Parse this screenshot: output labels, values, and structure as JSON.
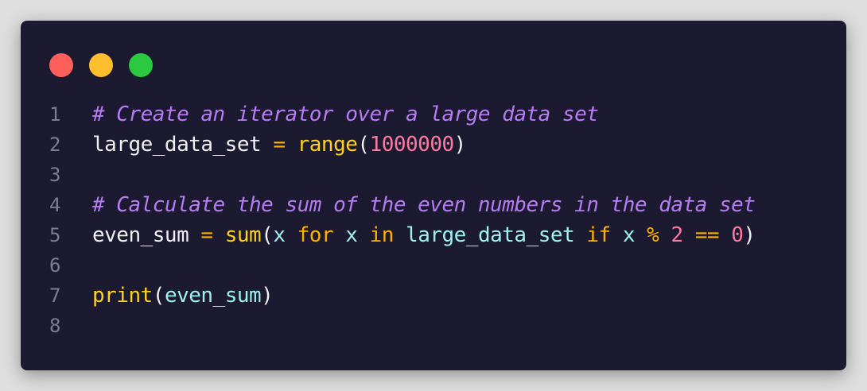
{
  "window": {
    "controls": [
      {
        "name": "close-dot",
        "color": "#ff5f5a"
      },
      {
        "name": "minimize-dot",
        "color": "#ffbe2e"
      },
      {
        "name": "maximize-dot",
        "color": "#2ac93f"
      }
    ]
  },
  "colors": {
    "background": "#1b1a30",
    "comment": "#b77cf2",
    "identifier": "#f2f2f2",
    "variable": "#9ef0f3",
    "operator": "#ffb000",
    "builtin": "#ffd21f",
    "number": "#ff7aa0",
    "line_number": "#7c7c97"
  },
  "code": {
    "lines": [
      {
        "number": "1",
        "tokens": [
          {
            "text": "# Create an iterator over a large data set",
            "type": "comment"
          }
        ]
      },
      {
        "number": "2",
        "tokens": [
          {
            "text": "large_data_set",
            "type": "ident"
          },
          {
            "text": " ",
            "type": "ident"
          },
          {
            "text": "=",
            "type": "op"
          },
          {
            "text": " ",
            "type": "ident"
          },
          {
            "text": "range",
            "type": "builtin"
          },
          {
            "text": "(",
            "type": "paren"
          },
          {
            "text": "1000000",
            "type": "num"
          },
          {
            "text": ")",
            "type": "paren"
          }
        ]
      },
      {
        "number": "3",
        "tokens": []
      },
      {
        "number": "4",
        "tokens": [
          {
            "text": "# Calculate the sum of the even numbers in the data set",
            "type": "comment"
          }
        ]
      },
      {
        "number": "5",
        "tokens": [
          {
            "text": "even_sum",
            "type": "ident"
          },
          {
            "text": " ",
            "type": "ident"
          },
          {
            "text": "=",
            "type": "op"
          },
          {
            "text": " ",
            "type": "ident"
          },
          {
            "text": "sum",
            "type": "builtin"
          },
          {
            "text": "(",
            "type": "paren"
          },
          {
            "text": "x",
            "type": "var"
          },
          {
            "text": " ",
            "type": "ident"
          },
          {
            "text": "for",
            "type": "kw"
          },
          {
            "text": " ",
            "type": "ident"
          },
          {
            "text": "x",
            "type": "var"
          },
          {
            "text": " ",
            "type": "ident"
          },
          {
            "text": "in",
            "type": "kw"
          },
          {
            "text": " ",
            "type": "ident"
          },
          {
            "text": "large_data_set",
            "type": "var"
          },
          {
            "text": " ",
            "type": "ident"
          },
          {
            "text": "if",
            "type": "kw"
          },
          {
            "text": " ",
            "type": "ident"
          },
          {
            "text": "x",
            "type": "var"
          },
          {
            "text": " ",
            "type": "ident"
          },
          {
            "text": "%",
            "type": "op"
          },
          {
            "text": " ",
            "type": "ident"
          },
          {
            "text": "2",
            "type": "num"
          },
          {
            "text": " ",
            "type": "ident"
          },
          {
            "text": "==",
            "type": "op"
          },
          {
            "text": " ",
            "type": "ident"
          },
          {
            "text": "0",
            "type": "num"
          },
          {
            "text": ")",
            "type": "paren"
          }
        ]
      },
      {
        "number": "6",
        "tokens": []
      },
      {
        "number": "7",
        "tokens": [
          {
            "text": "print",
            "type": "builtin"
          },
          {
            "text": "(",
            "type": "paren"
          },
          {
            "text": "even_sum",
            "type": "var"
          },
          {
            "text": ")",
            "type": "paren"
          }
        ]
      },
      {
        "number": "8",
        "tokens": []
      }
    ]
  }
}
